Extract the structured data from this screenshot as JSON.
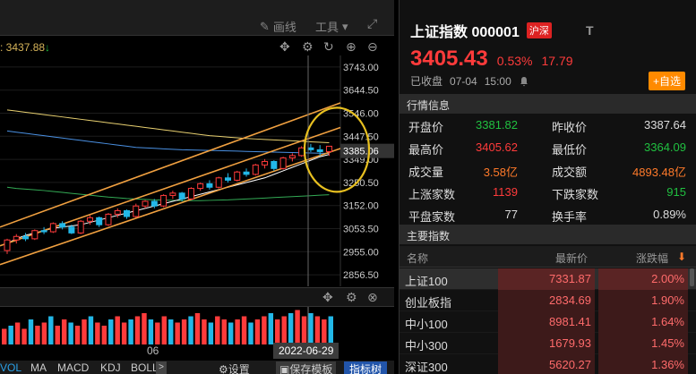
{
  "toolbar": {
    "draw_label": "画线",
    "tools_label": "工具",
    "ma_price_label": ": 3437.88"
  },
  "main_chart": {
    "y_ticks": [
      "3743.00",
      "3644.50",
      "3546.00",
      "3447.50",
      "3349.00",
      "3250.50",
      "3152.00",
      "3053.50",
      "2955.00",
      "2856.50"
    ],
    "cursor_price": "3385.06"
  },
  "chart_data": {
    "type": "candlestick",
    "ylim": [
      2807.25,
      3792.25
    ],
    "y_ticks": [
      3743.0,
      3644.5,
      3546.0,
      3447.5,
      3349.0,
      3250.5,
      3152.0,
      3053.5,
      2955.0,
      2856.5
    ],
    "cursor_price": 3385.06,
    "candles": [
      [
        2960,
        3010,
        2945,
        3005
      ],
      [
        3005,
        3030,
        2990,
        3020
      ],
      [
        3020,
        3035,
        3000,
        3010
      ],
      [
        3010,
        3050,
        3005,
        3045
      ],
      [
        3045,
        3060,
        3030,
        3040
      ],
      [
        3040,
        3080,
        3035,
        3075
      ],
      [
        3075,
        3085,
        3050,
        3060
      ],
      [
        3060,
        3070,
        3030,
        3035
      ],
      [
        3035,
        3090,
        3030,
        3085
      ],
      [
        3085,
        3110,
        3070,
        3100
      ],
      [
        3100,
        3105,
        3060,
        3070
      ],
      [
        3070,
        3120,
        3065,
        3115
      ],
      [
        3115,
        3140,
        3100,
        3130
      ],
      [
        3130,
        3135,
        3095,
        3105
      ],
      [
        3105,
        3160,
        3100,
        3150
      ],
      [
        3150,
        3175,
        3140,
        3170
      ],
      [
        3170,
        3180,
        3140,
        3150
      ],
      [
        3150,
        3200,
        3145,
        3195
      ],
      [
        3195,
        3215,
        3180,
        3205
      ],
      [
        3205,
        3210,
        3170,
        3180
      ],
      [
        3180,
        3230,
        3175,
        3225
      ],
      [
        3225,
        3250,
        3215,
        3245
      ],
      [
        3245,
        3260,
        3220,
        3230
      ],
      [
        3230,
        3275,
        3225,
        3270
      ],
      [
        3270,
        3290,
        3250,
        3260
      ],
      [
        3260,
        3300,
        3255,
        3295
      ],
      [
        3295,
        3310,
        3275,
        3285
      ],
      [
        3285,
        3330,
        3280,
        3325
      ],
      [
        3325,
        3350,
        3310,
        3340
      ],
      [
        3340,
        3345,
        3300,
        3310
      ],
      [
        3310,
        3360,
        3305,
        3355
      ],
      [
        3355,
        3375,
        3340,
        3365
      ],
      [
        3365,
        3405,
        3360,
        3398
      ],
      [
        3398,
        3415,
        3380,
        3390
      ],
      [
        3390,
        3410,
        3364,
        3382
      ],
      [
        3382,
        3406,
        3364,
        3405
      ]
    ],
    "ma_lines": [
      {
        "color": "#e8d070",
        "values": [
          3560,
          3555,
          3550,
          3545,
          3540,
          3535,
          3530,
          3525,
          3520,
          3515,
          3510,
          3505,
          3500,
          3495,
          3490,
          3485,
          3480,
          3475,
          3470,
          3465,
          3460,
          3455,
          3450,
          3447,
          3444,
          3441,
          3438,
          3436,
          3434,
          3432,
          3430,
          3428,
          3426,
          3424,
          3422,
          3420
        ]
      },
      {
        "color": "#4a90e2",
        "values": [
          3470,
          3465,
          3460,
          3455,
          3450,
          3445,
          3440,
          3435,
          3430,
          3425,
          3420,
          3415,
          3410,
          3405,
          3400,
          3398,
          3396,
          3394,
          3392,
          3390,
          3389,
          3388,
          3387,
          3386,
          3385,
          3384,
          3383,
          3382,
          3381,
          3380,
          3379,
          3378,
          3377,
          3376,
          3375,
          3374
        ]
      },
      {
        "color": "#33aa55",
        "values": [
          3230,
          3225,
          3222,
          3219,
          3216,
          3212,
          3208,
          3204,
          3200,
          3196,
          3192,
          3188,
          3185,
          3182,
          3180,
          3178,
          3176,
          3175,
          3174,
          3173,
          3173,
          3173,
          3174,
          3175,
          3176,
          3178,
          3180,
          3182,
          3184,
          3186,
          3188,
          3190,
          3192,
          3194,
          3196,
          3198
        ]
      },
      {
        "color": "#ffffff",
        "values": [
          2990,
          3010,
          3025,
          3035,
          3045,
          3055,
          3060,
          3065,
          3070,
          3080,
          3090,
          3100,
          3110,
          3120,
          3130,
          3140,
          3150,
          3160,
          3170,
          3180,
          3190,
          3200,
          3210,
          3220,
          3230,
          3240,
          3250,
          3260,
          3270,
          3285,
          3300,
          3315,
          3330,
          3345,
          3360,
          3370
        ]
      }
    ],
    "channel": {
      "upper": [
        [
          3040,
          3580
        ]
      ],
      "mid": [
        [
          2960,
          3470
        ]
      ],
      "lower": [
        [
          2880,
          3380
        ]
      ]
    },
    "volume": [
      5,
      6,
      7,
      5,
      8,
      6,
      7,
      9,
      6,
      8,
      7,
      6,
      8,
      9,
      7,
      6,
      8,
      9,
      7,
      8,
      9,
      10,
      8,
      7,
      9,
      8,
      7,
      8,
      9,
      10,
      8,
      7,
      9,
      8,
      7,
      8,
      9,
      7,
      8,
      9,
      10,
      8,
      9,
      10,
      11,
      9,
      10,
      9,
      8,
      9
    ]
  },
  "date_axis": {
    "month_label": "06",
    "cursor_date": "2022-06-29"
  },
  "bottom_tabs": {
    "vol": "VOL",
    "ma": "MA",
    "macd": "MACD",
    "kdj": "KDJ",
    "boll": "BOLL",
    "more": ">",
    "settings": "设置",
    "save_template": "保存模板",
    "indicator_tree": "指标树"
  },
  "info": {
    "index_name": "上证指数 000001",
    "market_badge": "沪深",
    "t_label": "T",
    "current_price": "3405.43",
    "change_pct": "0.53%",
    "change_val": "17.79",
    "status": "已收盘",
    "date": "07-04",
    "time": "15:00",
    "add_fav": "自选"
  },
  "quote_section": {
    "title": "行情信息",
    "rows": [
      {
        "l1": "开盘价",
        "v1": "3381.82",
        "l2": "昨收价",
        "v2": "3387.64"
      },
      {
        "l1": "最高价",
        "v1": "3405.62",
        "l2": "最低价",
        "v2": "3364.09"
      },
      {
        "l1": "成交量",
        "v1": "3.58亿",
        "l2": "成交额",
        "v2": "4893.48亿"
      },
      {
        "l1": "上涨家数",
        "v1": "1139",
        "l2": "下跌家数",
        "v2": "915"
      },
      {
        "l1": "平盘家数",
        "v1": "77",
        "l2": "换手率",
        "v2": "0.89%"
      }
    ]
  },
  "indices_section": {
    "title": "主要指数",
    "col_name": "名称",
    "col_price": "最新价",
    "col_pct": "涨跌幅",
    "rows": [
      {
        "name": "上证100",
        "price": "7331.87",
        "pct": "2.00%"
      },
      {
        "name": "创业板指",
        "price": "2834.69",
        "pct": "1.90%"
      },
      {
        "name": "中小100",
        "price": "8981.41",
        "pct": "1.64%"
      },
      {
        "name": "中小300",
        "price": "1679.93",
        "pct": "1.45%"
      },
      {
        "name": "深证300",
        "price": "5620.27",
        "pct": "1.36%"
      }
    ]
  },
  "colors": {
    "up": "#ff3b3b",
    "down": "#20c040",
    "accent": "#ff8a00",
    "highlight_ring": "#e8c020"
  }
}
